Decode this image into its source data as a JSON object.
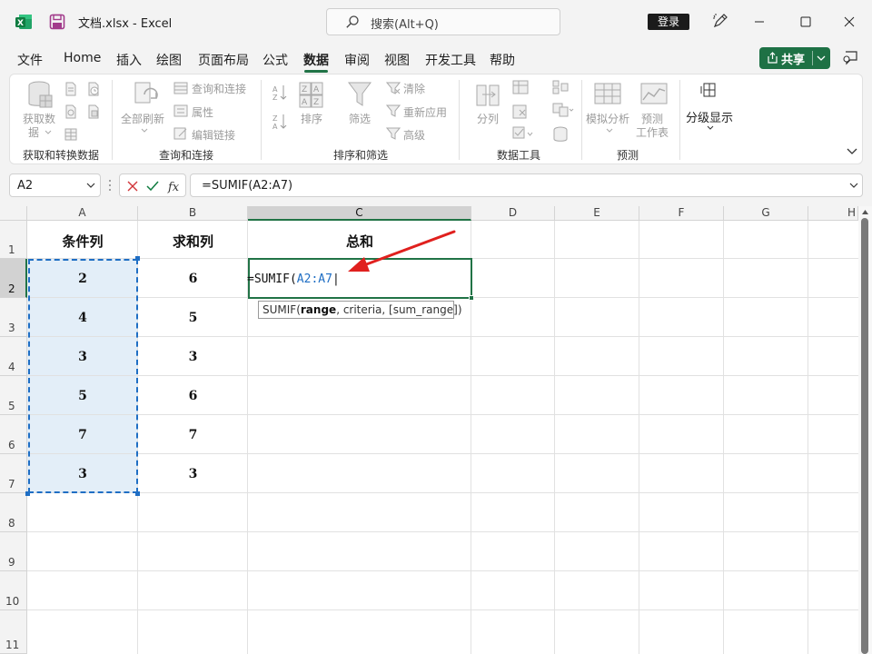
{
  "titlebar": {
    "file_title": "文档.xlsx  -  Excel",
    "search_placeholder": "搜索(Alt+Q)",
    "login_label": "登录"
  },
  "menu": {
    "items": [
      "文件",
      "Home",
      "插入",
      "绘图",
      "页面布局",
      "公式",
      "数据",
      "审阅",
      "视图",
      "开发工具",
      "帮助"
    ],
    "active": "数据",
    "share_label": "共享"
  },
  "ribbon": {
    "groups": [
      {
        "label": "获取和转换数据",
        "buttons": [
          "获取数据"
        ]
      },
      {
        "label": "查询和连接",
        "buttons": [
          "全部刷新",
          "查询和连接",
          "属性",
          "编辑链接"
        ]
      },
      {
        "label": "排序和筛选",
        "buttons": [
          "排序",
          "筛选",
          "清除",
          "重新应用",
          "高级"
        ]
      },
      {
        "label": "数据工具",
        "buttons": [
          "分列"
        ]
      },
      {
        "label": "预测",
        "buttons": [
          "模拟分析",
          "预测工作表"
        ]
      }
    ],
    "get_data_label_1": "获取数",
    "get_data_label_2": "据",
    "refresh_all_label": "全部刷新",
    "queries_label": "查询和连接",
    "properties_label": "属性",
    "edit_links_label": "编辑链接",
    "sort_label": "排序",
    "filter_label": "筛选",
    "clear_label": "清除",
    "reapply_label": "重新应用",
    "advanced_label": "高级",
    "text_to_cols_label": "分列",
    "what_if_label": "模拟分析",
    "forecast_label_1": "预测",
    "forecast_label_2": "工作表",
    "outline_label": "分级显示"
  },
  "formula_bar": {
    "name_box": "A2",
    "formula": "=SUMIF(A2:A7)"
  },
  "grid": {
    "columns": [
      "A",
      "B",
      "C",
      "D",
      "E",
      "F",
      "G",
      "H"
    ],
    "selected_column": "C",
    "rows": [
      "1",
      "2",
      "3",
      "4",
      "5",
      "6",
      "7",
      "8",
      "9",
      "10",
      "11"
    ],
    "selected_row": "2",
    "header_row": [
      "条件列",
      "求和列",
      "总和"
    ],
    "data": [
      [
        "2",
        "6"
      ],
      [
        "4",
        "5"
      ],
      [
        "3",
        "3"
      ],
      [
        "5",
        "6"
      ],
      [
        "7",
        "7"
      ],
      [
        "3",
        "3"
      ]
    ],
    "editing_cell": {
      "prefix": "=SUMIF(",
      "ref": "A2:A7"
    },
    "tooltip": {
      "fn": "SUMIF(",
      "arg_bold": "range",
      "rest": ", criteria, [sum_range])"
    }
  },
  "colors": {
    "accent": "#217346",
    "selection_blue": "#1f6ec4",
    "arrow_red": "#e0201e"
  }
}
